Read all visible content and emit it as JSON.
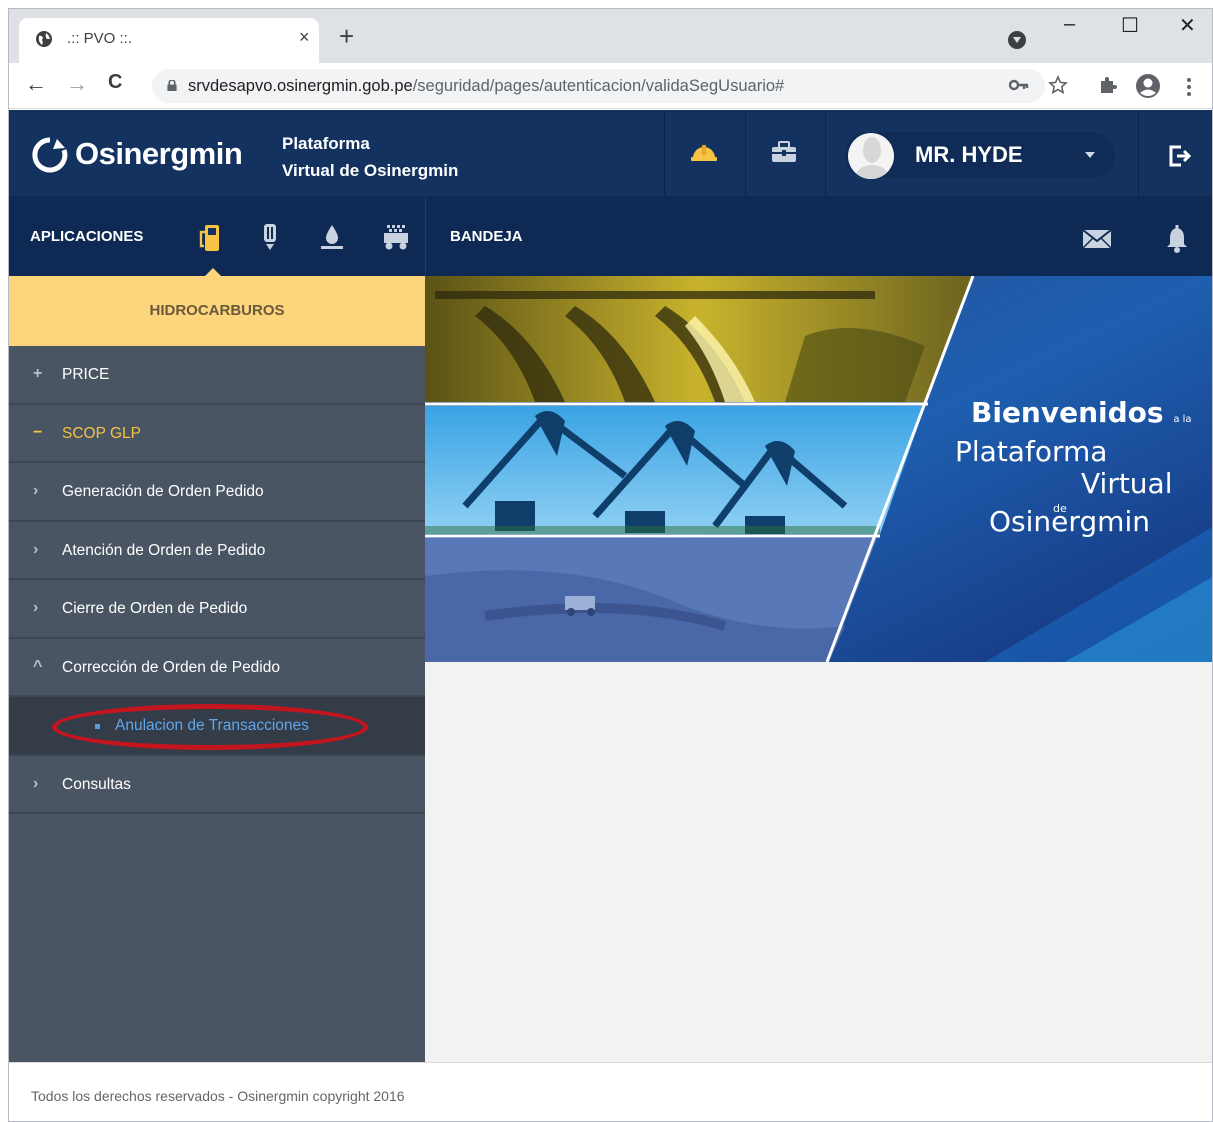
{
  "browser": {
    "tab_title": ".:: PVO ::.",
    "tab_close": "×",
    "new_tab": "+",
    "url_host": "srvdesapvo.osinergmin.gob.pe",
    "url_path": "/seguridad/pages/autenticacion/validaSegUsuario#",
    "window_controls": {
      "minimize": "–",
      "maximize": "☐",
      "close": "✕"
    },
    "nav": {
      "back": "←",
      "forward": "→",
      "reload": "C"
    }
  },
  "header": {
    "logo_text": "Osinergmin",
    "platform_line1": "Plataforma",
    "platform_line2": "Virtual de Osinergmin",
    "user_name": "MR. HYDE"
  },
  "subbar": {
    "apps_label": "APLICACIONES",
    "bandeja_label": "BANDEJA"
  },
  "sidebar": {
    "section_title": "HIDROCARBUROS",
    "items": [
      {
        "icon": "+",
        "label": "PRICE"
      },
      {
        "icon": "−",
        "label": "SCOP GLP"
      },
      {
        "icon": "›",
        "label": "Generación de Orden Pedido"
      },
      {
        "icon": "›",
        "label": "Atención de Orden de Pedido"
      },
      {
        "icon": "›",
        "label": "Cierre de Orden de Pedido"
      },
      {
        "icon": "^",
        "label": "Corrección de Orden de Pedido"
      },
      {
        "label": "Anulacion de Transacciones"
      },
      {
        "icon": "›",
        "label": "Consultas"
      }
    ]
  },
  "banner": {
    "line1": "Bienvenidos",
    "line1_small": "a la",
    "line2": "Plataforma",
    "line3": "Virtual",
    "line3_small": "de",
    "line4": "Osinergmin"
  },
  "footer": {
    "text": "Todos los derechos reservados - Osinergmin copyright 2016"
  },
  "colors": {
    "header_bg": "#14325f",
    "subbar_bg": "#0e2a54",
    "sidebar_bg": "#4a5564",
    "section_bg": "#fcd57d",
    "active_text": "#f5c242",
    "link_text": "#5fa6ea",
    "highlight_circle": "#c4141e"
  }
}
